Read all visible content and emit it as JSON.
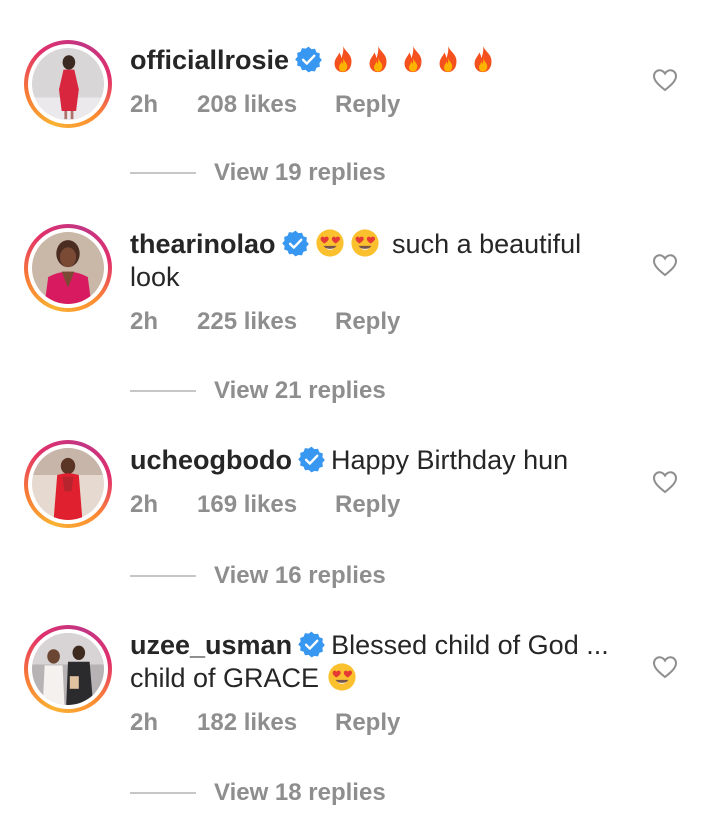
{
  "comments": [
    {
      "username": "officiallrosie",
      "verified": true,
      "emojis": [
        "fire",
        "fire",
        "fire",
        "fire",
        "fire"
      ],
      "text_line1": "",
      "text_line2": "",
      "time": "2h",
      "likes": "208 likes",
      "reply": "Reply",
      "view_replies": "View 19 replies"
    },
    {
      "username": "thearinolao",
      "verified": true,
      "emojis": [
        "heart-eyes",
        "heart-eyes"
      ],
      "text_line1": "such a beautiful",
      "text_line2": "look",
      "time": "2h",
      "likes": "225 likes",
      "reply": "Reply",
      "view_replies": "View 21 replies"
    },
    {
      "username": "ucheogbodo",
      "verified": true,
      "emojis": [],
      "text_line1": "Happy Birthday hun",
      "text_line2": "",
      "time": "2h",
      "likes": "169 likes",
      "reply": "Reply",
      "view_replies": "View 16 replies"
    },
    {
      "username": "uzee_usman",
      "verified": true,
      "emojis": [
        "heart-eyes"
      ],
      "text_line1": "Blessed child of God ...",
      "text_line2": "child of GRACE",
      "time": "2h",
      "likes": "182 likes",
      "reply": "Reply",
      "view_replies": "View 18 replies"
    }
  ],
  "colors": {
    "text": "#262626",
    "muted": "#8e8e8e",
    "verified_blue": "#3897f0",
    "heart_outline": "#8e8e8e"
  }
}
